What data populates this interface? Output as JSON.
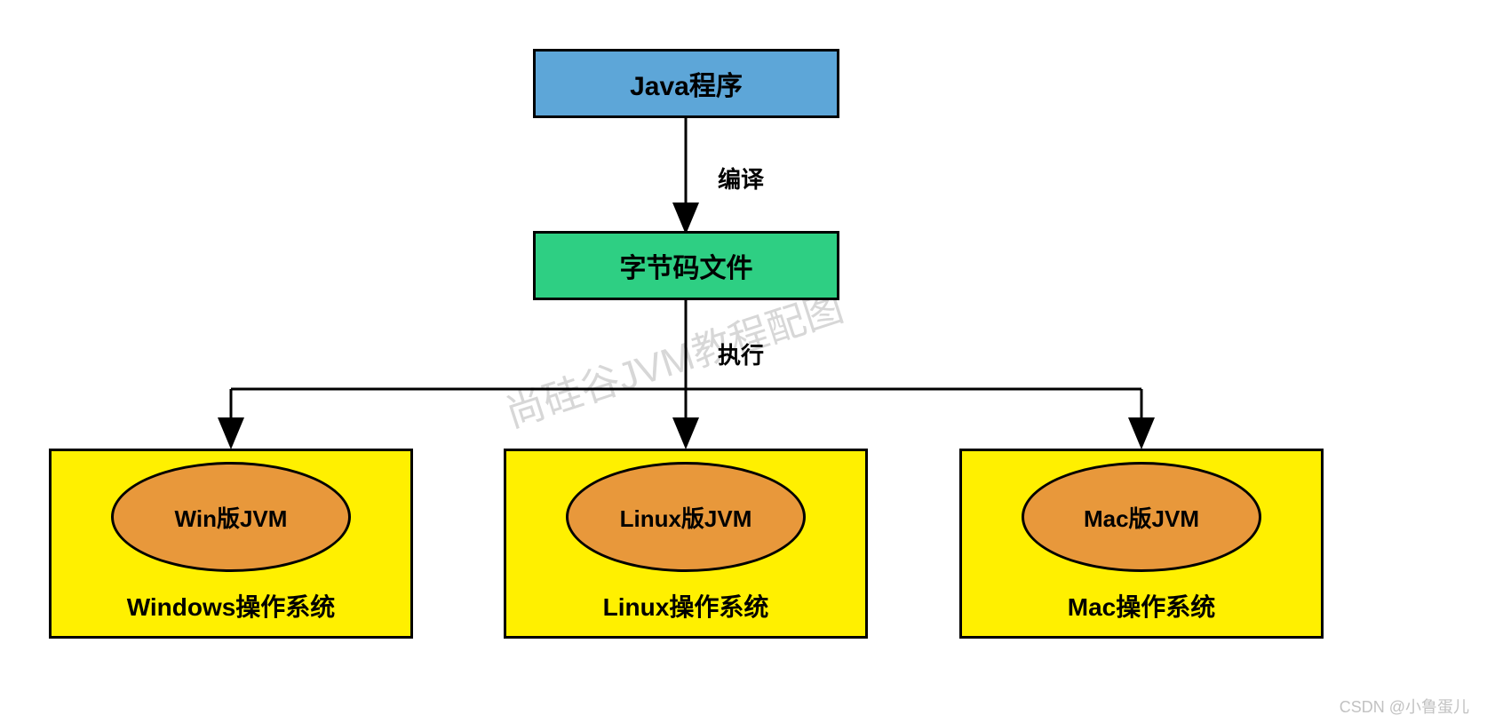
{
  "nodes": {
    "javaProgram": "Java程序",
    "bytecode": "字节码文件"
  },
  "edges": {
    "compile": "编译",
    "execute": "执行"
  },
  "platforms": [
    {
      "jvm": "Win版JVM",
      "os": "Windows操作系统"
    },
    {
      "jvm": "Linux版JVM",
      "os": "Linux操作系统"
    },
    {
      "jvm": "Mac版JVM",
      "os": "Mac操作系统"
    }
  ],
  "watermark": "尚硅谷JVM教程配图",
  "credit": "CSDN @小鲁蛋儿"
}
